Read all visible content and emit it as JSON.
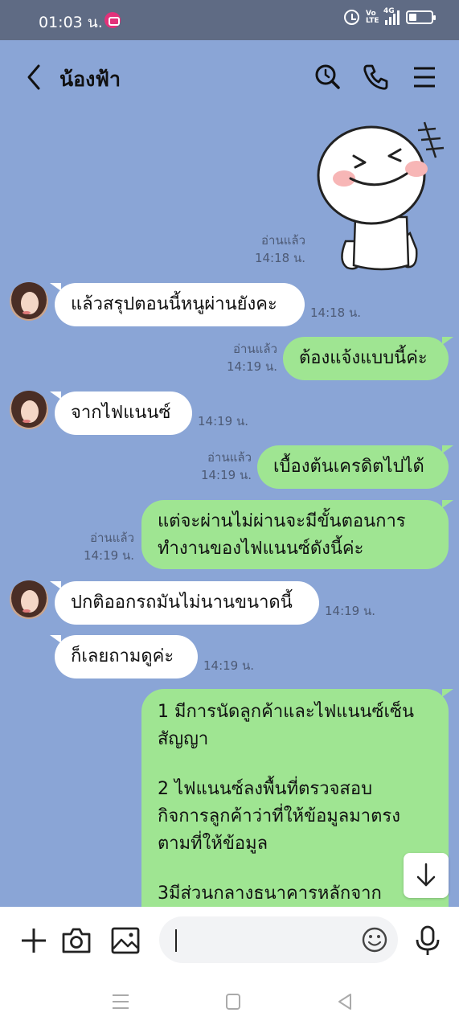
{
  "status_bar": {
    "time": "01:03 น.",
    "volte": "Vo LTE",
    "network": "4G"
  },
  "header": {
    "title": "น้องฟ้า",
    "icons": [
      "back-icon",
      "search-icon",
      "phone-icon",
      "menu-icon"
    ]
  },
  "messages": [
    {
      "type": "sticker",
      "direction": "out",
      "read": "อ่านแล้ว",
      "time": "14:18 น."
    },
    {
      "type": "text",
      "direction": "in",
      "text": "แล้วสรุปตอนนี้หนูผ่านยังคะ",
      "time": "14:18 น."
    },
    {
      "type": "text",
      "direction": "out",
      "text": "ต้องแจ้งแบบนี้ค่ะ",
      "read": "อ่านแล้ว",
      "time": "14:19 น."
    },
    {
      "type": "text",
      "direction": "in",
      "text": "จากไฟแนนซ์",
      "time": "14:19 น."
    },
    {
      "type": "text",
      "direction": "out",
      "text": "เบื้องต้นเครดิตไปได้",
      "read": "อ่านแล้ว",
      "time": "14:19 น."
    },
    {
      "type": "text",
      "direction": "out",
      "lines": [
        "แต่จะผ่านไม่ผ่านจะมีขั้นตอนการ",
        "ทำงานของไฟแนนซ์ดังนี้ค่ะ"
      ],
      "read": "อ่านแล้ว",
      "time": "14:19 น."
    },
    {
      "type": "text",
      "direction": "in",
      "text": "ปกติออกรถมันไม่นานขนาดนี้",
      "time": "14:19 น."
    },
    {
      "type": "text",
      "direction": "in",
      "text": "ก็เลยถามดูค่ะ",
      "time": "14:19 น."
    },
    {
      "type": "text",
      "direction": "out",
      "paragraphs": [
        [
          "1 มีการนัดลูกค้าและไฟแนนซ์เซ็น",
          "สัญญา"
        ],
        [
          "2 ไฟแนนซ์ลงพื้นที่ตรวจสอบ",
          "กิจการลูกค้าว่าที่ให้ข้อมูลมาตรง",
          "ตามที่ให้ข้อมูล"
        ],
        [
          "3มีส่วนกลางธนาคารหลักจาก"
        ]
      ]
    }
  ],
  "input": {
    "placeholder": "",
    "icons": [
      "plus-icon",
      "camera-icon",
      "image-icon",
      "emoji-icon",
      "microphone-icon"
    ]
  },
  "colors": {
    "chat_background": "#8aa5d6",
    "outgoing_bubble": "#9fe592",
    "incoming_bubble": "#ffffff",
    "status_bar": "#5f6b84"
  }
}
